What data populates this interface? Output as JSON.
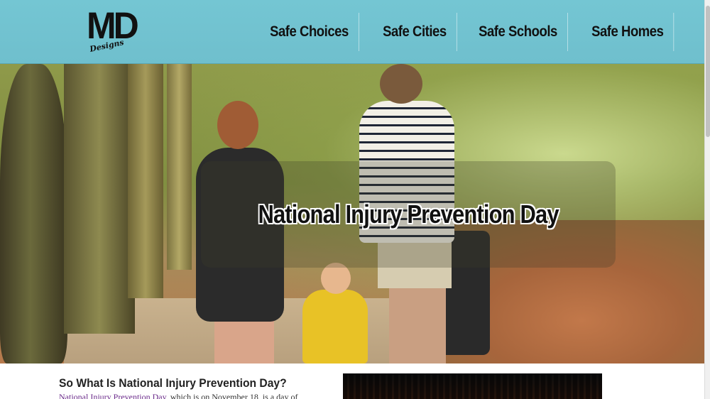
{
  "brand": {
    "logo_main": "MD",
    "logo_sub": "Designs"
  },
  "nav": {
    "items": [
      {
        "label": "Safe Choices"
      },
      {
        "label": "Safe Cities"
      },
      {
        "label": "Safe Schools"
      },
      {
        "label": "Safe Homes"
      }
    ]
  },
  "hero": {
    "title": "National Injury Prevention Day"
  },
  "content": {
    "heading": "So What Is National Injury Prevention Day?",
    "intro_link": "National Injury Prevention Day",
    "intro_text": ", which is on November 18, is a day of"
  },
  "colors": {
    "header_bg": "#74c6d3",
    "link": "#6a2a8a",
    "text": "#222222"
  }
}
